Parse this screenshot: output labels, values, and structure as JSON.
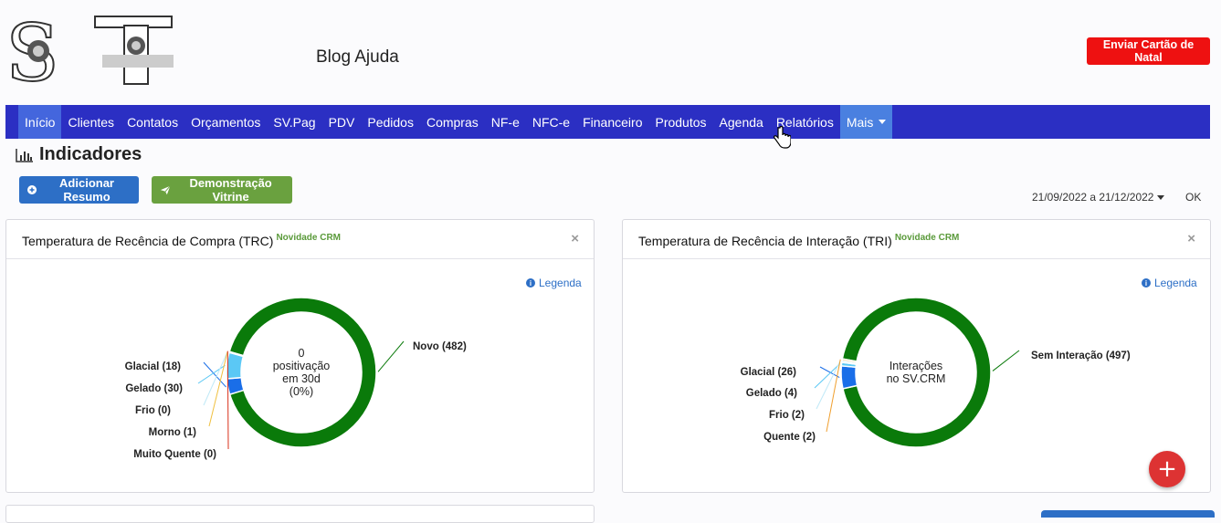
{
  "header": {
    "logo_letters": "ST",
    "brand": "Blog Ajuda",
    "xmas_button": "Enviar Cartão de Natal"
  },
  "nav": {
    "items": [
      {
        "label": "Início",
        "active": true
      },
      {
        "label": "Clientes"
      },
      {
        "label": "Contatos"
      },
      {
        "label": "Orçamentos"
      },
      {
        "label": "SV.Pag"
      },
      {
        "label": "PDV"
      },
      {
        "label": "Pedidos"
      },
      {
        "label": "Compras"
      },
      {
        "label": "NF-e"
      },
      {
        "label": "NFC-e"
      },
      {
        "label": "Financeiro"
      },
      {
        "label": "Produtos"
      },
      {
        "label": "Agenda"
      },
      {
        "label": "Relatórios"
      },
      {
        "label": "Mais",
        "dropdown": true,
        "hover": true
      }
    ]
  },
  "page": {
    "title": "Indicadores",
    "title_icon": "bar-chart-icon",
    "add_button": "Adicionar Resumo",
    "demo_button": "Demonstração Vitrine",
    "date_range": "21/09/2022 a 21/12/2022",
    "ok": "OK",
    "fab_label": "+"
  },
  "cards": [
    {
      "title": "Temperatura de Recência de Compra (TRC)",
      "badge": "Novidade CRM",
      "legend": "Legenda",
      "close": "×",
      "center_text": [
        "0",
        "positivação",
        "em 30d",
        "(0%)"
      ]
    },
    {
      "title": "Temperatura de Recência de Interação (TRI)",
      "badge": "Novidade CRM",
      "legend": "Legenda",
      "close": "×",
      "center_text": [
        "Interações",
        "no SV.CRM"
      ]
    }
  ],
  "chart_data": [
    {
      "type": "pie",
      "title": "Temperatura de Recência de Compra (TRC)",
      "donut": true,
      "slices": [
        {
          "label": "Novo (482)",
          "value": 482,
          "color": "#0a7a0a"
        },
        {
          "label": "Glacial (18)",
          "value": 18,
          "color": "#1a6ee8"
        },
        {
          "label": "Gelado (30)",
          "value": 30,
          "color": "#5bc8f5"
        },
        {
          "label": "Frio (0)",
          "value": 0,
          "color": "#bfe9f7"
        },
        {
          "label": "Morno (1)",
          "value": 1,
          "color": "#f0c040"
        },
        {
          "label": "Muito Quente (0)",
          "value": 0,
          "color": "#d9301a"
        }
      ]
    },
    {
      "type": "pie",
      "title": "Temperatura de Recência de Interação (TRI)",
      "donut": true,
      "slices": [
        {
          "label": "Sem Interação (497)",
          "value": 497,
          "color": "#0a7a0a"
        },
        {
          "label": "Glacial (26)",
          "value": 26,
          "color": "#1a6ee8"
        },
        {
          "label": "Gelado (4)",
          "value": 4,
          "color": "#5bc8f5"
        },
        {
          "label": "Frio (2)",
          "value": 2,
          "color": "#bfe9f7"
        },
        {
          "label": "Quente (2)",
          "value": 2,
          "color": "#f0a030"
        }
      ]
    }
  ]
}
